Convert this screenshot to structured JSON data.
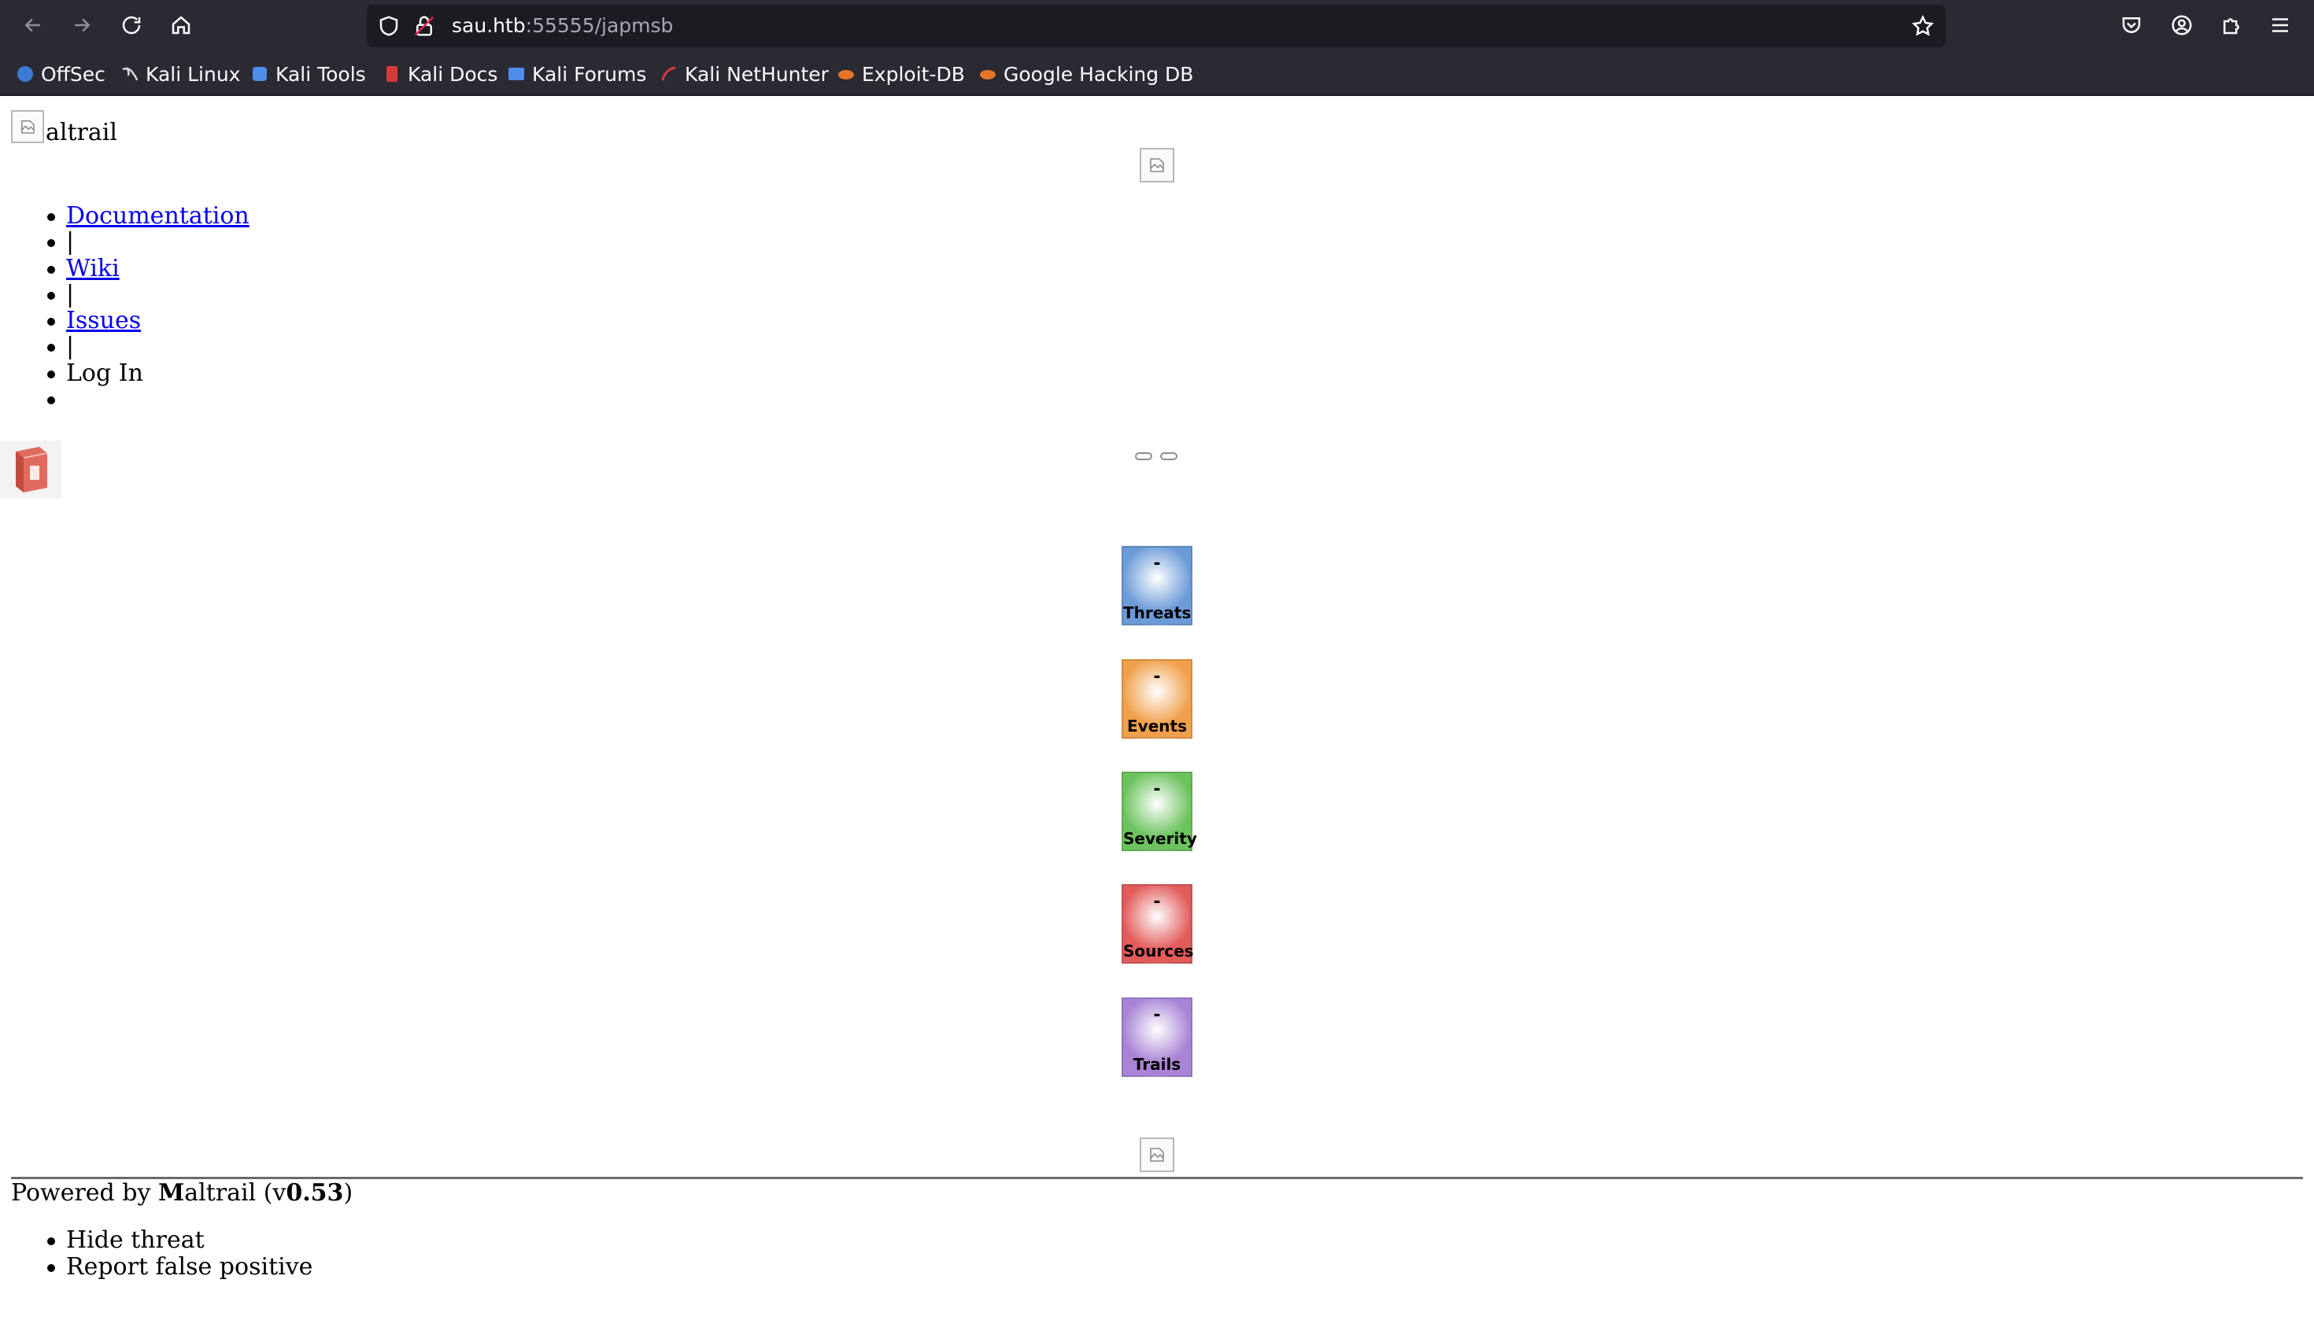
{
  "browser": {
    "url_host": "sau.htb",
    "url_path": ":55555/japmsb",
    "bookmarks": [
      {
        "label": "OffSec",
        "icon": "offsec-icon",
        "color": "#3b7bd4"
      },
      {
        "label": "Kali Linux",
        "icon": "kali-dragon-icon",
        "color": "#dddddd"
      },
      {
        "label": "Kali Tools",
        "icon": "kali-tools-icon",
        "color": "#4f8ee8"
      },
      {
        "label": "Kali Docs",
        "icon": "kali-docs-icon",
        "color": "#d63b3b"
      },
      {
        "label": "Kali Forums",
        "icon": "kali-forums-icon",
        "color": "#4f8ee8"
      },
      {
        "label": "Kali NetHunter",
        "icon": "nethunter-icon",
        "color": "#d63b3b"
      },
      {
        "label": "Exploit-DB",
        "icon": "exploitdb-icon",
        "color": "#e8742a"
      },
      {
        "label": "Google Hacking DB",
        "icon": "ghdb-icon",
        "color": "#e8742a"
      }
    ]
  },
  "header": {
    "logo_alt_text": "altrail"
  },
  "nav": {
    "documentation": "Documentation",
    "sep1": "|",
    "wiki": "Wiki",
    "sep2": "|",
    "issues": "Issues",
    "sep3": "|",
    "login": "Log In",
    "empty": ""
  },
  "tiles": [
    {
      "label": "Threats",
      "value": "-",
      "color": "#6c9bd8"
    },
    {
      "label": "Events",
      "value": "-",
      "color": "#f0a04b"
    },
    {
      "label": "Severity",
      "value": "-",
      "color": "#6cc35e"
    },
    {
      "label": "Sources",
      "value": "-",
      "color": "#e25c5c"
    },
    {
      "label": "Trails",
      "value": "-",
      "color": "#a883d6"
    }
  ],
  "footer": {
    "powered_prefix": "Powered by ",
    "powered_m": "M",
    "powered_rest": "altrail (v",
    "version": "0.53",
    "powered_close": ")"
  },
  "context_menu": {
    "hide_threat": "Hide threat",
    "report_false_positive": "Report false positive"
  }
}
